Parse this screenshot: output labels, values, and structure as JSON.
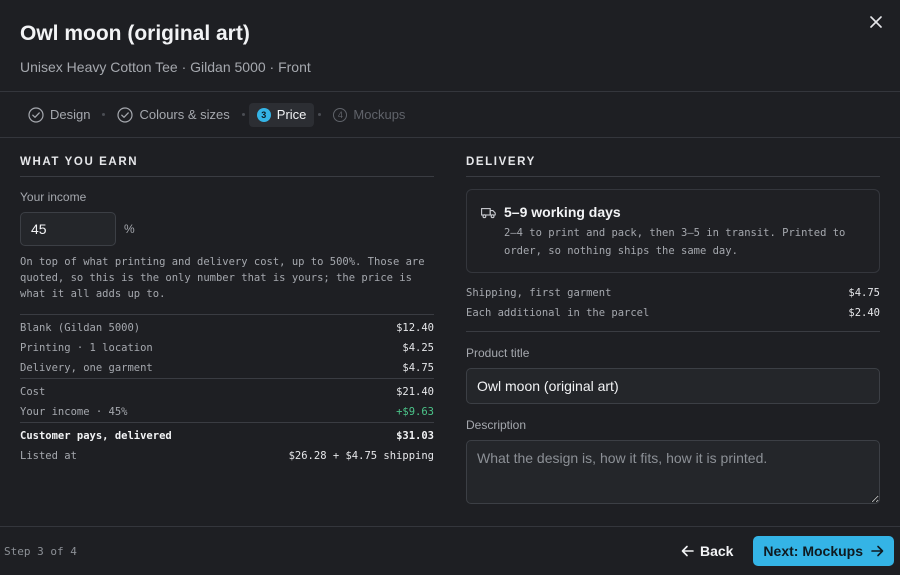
{
  "header": {
    "title": "Owl moon (original art)",
    "subtitle": "Unisex Heavy Cotton Tee · Gildan 5000 · Front"
  },
  "steps": [
    {
      "label": "Design",
      "state": "done"
    },
    {
      "label": "Colours & sizes",
      "state": "done"
    },
    {
      "label": "Price",
      "state": "active",
      "number": "3"
    },
    {
      "label": "Mockups",
      "state": "upcoming",
      "number": "4"
    }
  ],
  "earn": {
    "section_title": "WHAT YOU EARN",
    "income_label": "Your income",
    "income_value": "45",
    "income_unit": "%",
    "note": "On top of what printing and delivery cost, up to 500%. Those are quoted, so this is the only number that is yours; the price is what it all adds up to.",
    "costs": [
      {
        "label": "Blank (Gildan 5000)",
        "value": "$12.40"
      },
      {
        "label": "Printing · 1 location",
        "value": "$4.25"
      },
      {
        "label": "Delivery, one garment",
        "value": "$4.75"
      }
    ],
    "subtotal": [
      {
        "label": "Cost",
        "value": "$21.40"
      },
      {
        "label": "Your income · 45%",
        "value": "+$9.63"
      }
    ],
    "totals": [
      {
        "label": "Customer pays, delivered",
        "value": "$31.03"
      },
      {
        "label": "Listed at",
        "value": "$26.28 + $4.75 shipping"
      }
    ]
  },
  "delivery": {
    "section_title": "DELIVERY",
    "box_title": "5–9 working days",
    "box_text": "2–4 to print and pack, then 3–5 in transit. Printed to order, so nothing ships the same day.",
    "shipping": [
      {
        "label": "Shipping, first garment",
        "value": "$4.75"
      },
      {
        "label": "Each additional in the parcel",
        "value": "$2.40"
      }
    ],
    "product_title_label": "Product title",
    "product_title_value": "Owl moon (original art)",
    "description_label": "Description",
    "description_placeholder": "What the design is, how it fits, how it is printed."
  },
  "footer": {
    "step_count": "Step 3 of 4",
    "back_label": "Back",
    "next_label": "Next: Mockups"
  },
  "colors": {
    "accent": "#34b4e6",
    "positive": "#4cc58a",
    "background": "#1e1f23"
  },
  "icons": {
    "close": "close-icon",
    "done": "check-circle-icon",
    "delivery": "truck-icon",
    "back": "arrow-left-icon",
    "next": "arrow-right-icon"
  }
}
